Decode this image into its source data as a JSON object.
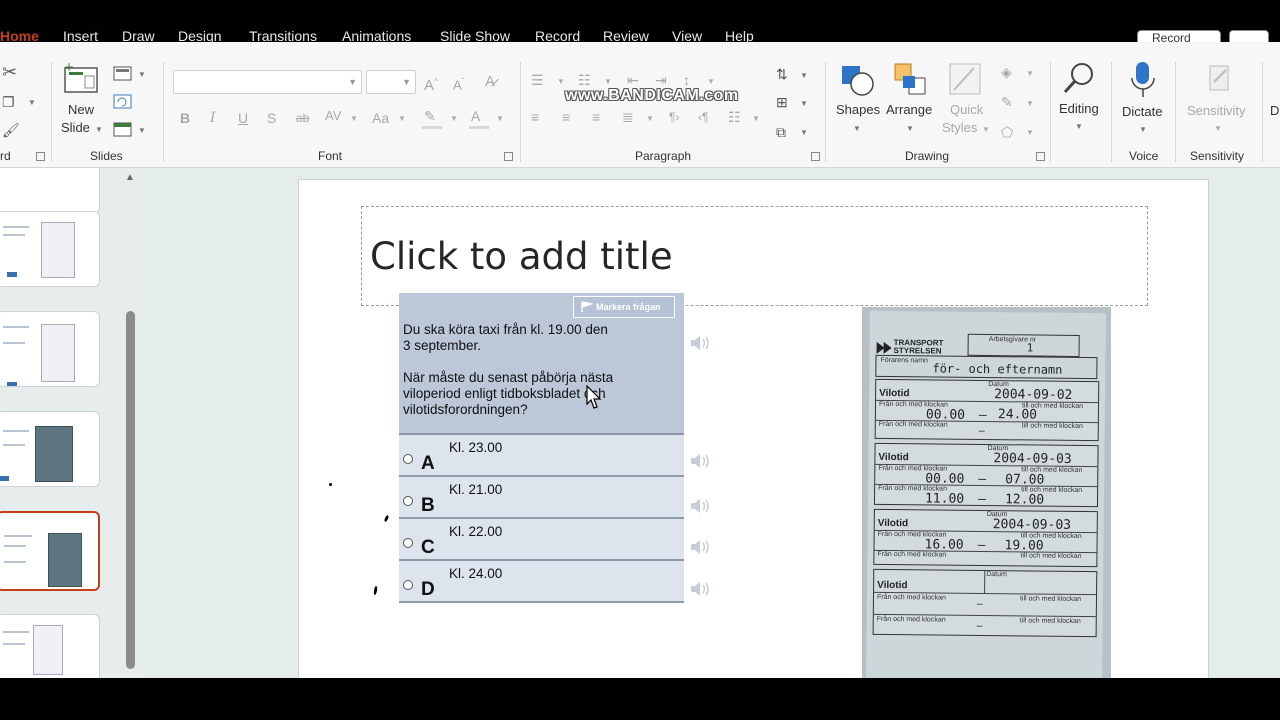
{
  "tabs": [
    {
      "label": "Home",
      "active": true
    },
    {
      "label": "Insert"
    },
    {
      "label": "Draw"
    },
    {
      "label": "Design"
    },
    {
      "label": "Transitions"
    },
    {
      "label": "Animations"
    },
    {
      "label": "Slide Show"
    },
    {
      "label": "Record"
    },
    {
      "label": "Review"
    },
    {
      "label": "View"
    },
    {
      "label": "Help"
    }
  ],
  "record_button": "Record",
  "watermark": "www.BANDICAM.com",
  "ribbon": {
    "clipboard_label": "rd",
    "new_slide_line1": "New",
    "new_slide_line2": "Slide",
    "slides_label": "Slides",
    "font_label": "Font",
    "paragraph_label": "Paragraph",
    "drawing_label": "Drawing",
    "shapes": "Shapes",
    "arrange": "Arrange",
    "quick_styles_line1": "Quick",
    "quick_styles_line2": "Styles",
    "editing": "Editing",
    "dictate": "Dictate",
    "voice_label": "Voice",
    "sensitivity": "Sensitivity",
    "sensitivity_label": "Sensitivity",
    "font_name": "",
    "font_size": ""
  },
  "slide": {
    "title_placeholder": "Click to add title",
    "quiz": {
      "flag_button": "Markera frågan",
      "question_line1": "Du ska köra taxi från kl. 19.00 den",
      "question_line2": "3 september.",
      "question_line3": "När måste du senast påbörja nästa",
      "question_line4": "viloperiod enligt tidboksbladet och",
      "question_line5": "vilotidsforordningen?",
      "answers": [
        {
          "letter": "A",
          "text": "Kl. 23.00"
        },
        {
          "letter": "B",
          "text": "Kl. 21.00"
        },
        {
          "letter": "C",
          "text": "Kl. 22.00"
        },
        {
          "letter": "D",
          "text": "Kl. 24.00"
        }
      ]
    },
    "document": {
      "agency": "TRANSPORT\nSTYRELSEN",
      "agency_line1": "TRANSPORT",
      "agency_line2": "STYRELSEN",
      "sheet_label": "Arbetsgivare nr",
      "sheet_no": "1",
      "name_label": "Förarens namn",
      "name_value": "för- och efternamn",
      "vilotid": "Vilotid",
      "datum": "Datum",
      "from_label": "Från och med klockan",
      "to_label": "till och med klockan",
      "date1": "2004-09-02",
      "r1_from": "00.00",
      "r1_to": "24.00",
      "date2": "2004-09-03",
      "r2_from": "00.00",
      "r2_to": "07.00",
      "r3_from": "11.00",
      "r3_to": "12.00",
      "date3": "2004-09-03",
      "r4_from": "16.00",
      "r4_to": "19.00",
      "dash": "–"
    }
  },
  "colors": {
    "accent": "#c43e1c",
    "question_bg": "#bcc7d8",
    "answer_bg": "#dde4ed"
  }
}
